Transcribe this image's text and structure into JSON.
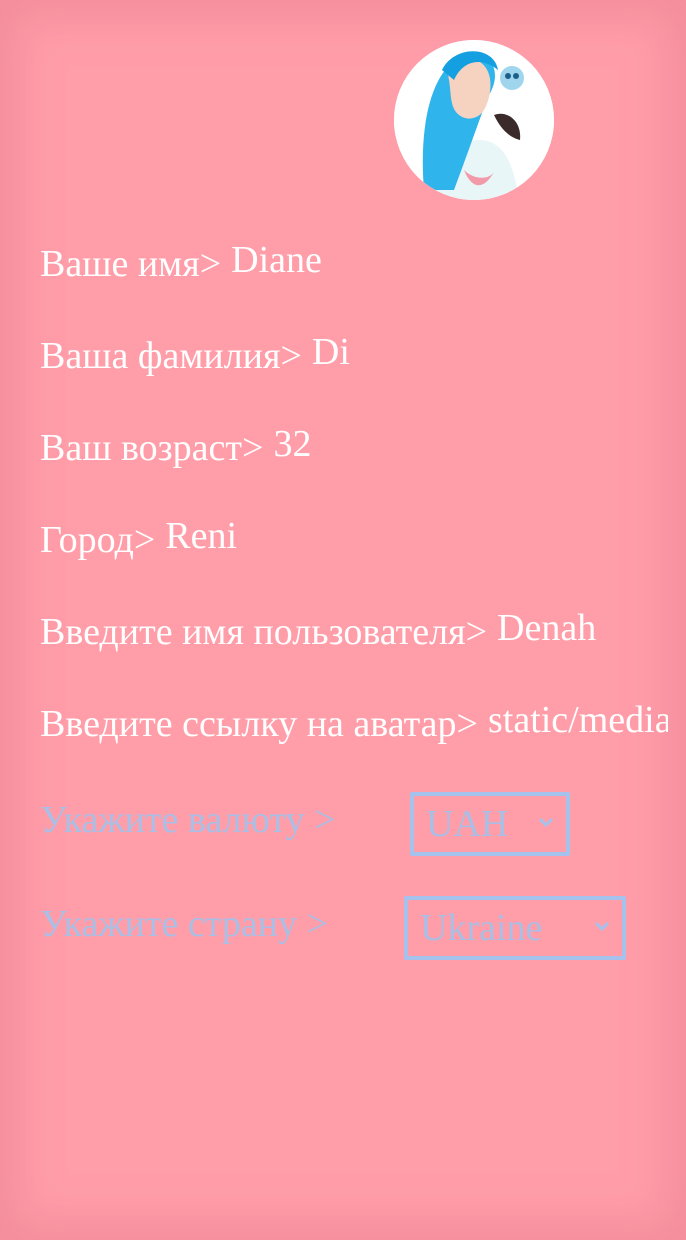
{
  "profile": {
    "fields": [
      {
        "label": "Ваше имя>",
        "value": "Diane"
      },
      {
        "label": "Ваша фамилия>",
        "value": "Di"
      },
      {
        "label": "Ваш возраст>",
        "value": "32"
      },
      {
        "label": "Город>",
        "value": "Reni"
      },
      {
        "label": "Введите имя пользователя>",
        "value": "Denah"
      },
      {
        "label": "Введите ссылку на аватар>",
        "value": "static/media/avatar.png"
      }
    ],
    "currency": {
      "label": "Укажите валюту >",
      "value": "UAH"
    },
    "country": {
      "label": "Укажите страну >",
      "value": "Ukraine"
    }
  },
  "colors": {
    "background": "#ff9da9",
    "text": "#ffffff",
    "select_text": "#a9bfe6",
    "select_border": "#a4c2ec"
  },
  "icons": {
    "avatar": "user-avatar-image",
    "dropdown": "chevron-down-icon"
  }
}
